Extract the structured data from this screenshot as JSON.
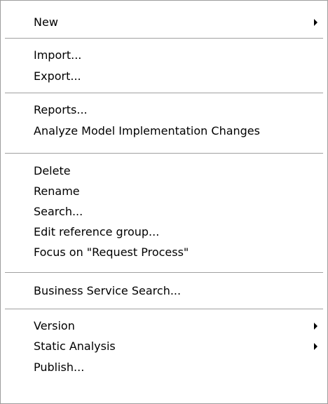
{
  "menu": {
    "items": [
      {
        "label": "New",
        "submenu": true
      },
      {
        "label": "Import..."
      },
      {
        "label": "Export..."
      },
      {
        "label": "Reports..."
      },
      {
        "label": "Analyze Model Implementation Changes"
      },
      {
        "label": "Delete"
      },
      {
        "label": "Rename"
      },
      {
        "label": "Search..."
      },
      {
        "label": "Edit reference group..."
      },
      {
        "label": "Focus on \"Request Process\""
      },
      {
        "label": "Business Service Search..."
      },
      {
        "label": "Version",
        "submenu": true
      },
      {
        "label": "Static Analysis",
        "submenu": true
      },
      {
        "label": "Publish..."
      }
    ]
  },
  "colors": {
    "background": "#ffffff",
    "text": "#000000",
    "separator": "#a0a0a0",
    "border": "#9d9d9d"
  },
  "icons": {
    "submenu": "submenu-arrow-icon"
  }
}
